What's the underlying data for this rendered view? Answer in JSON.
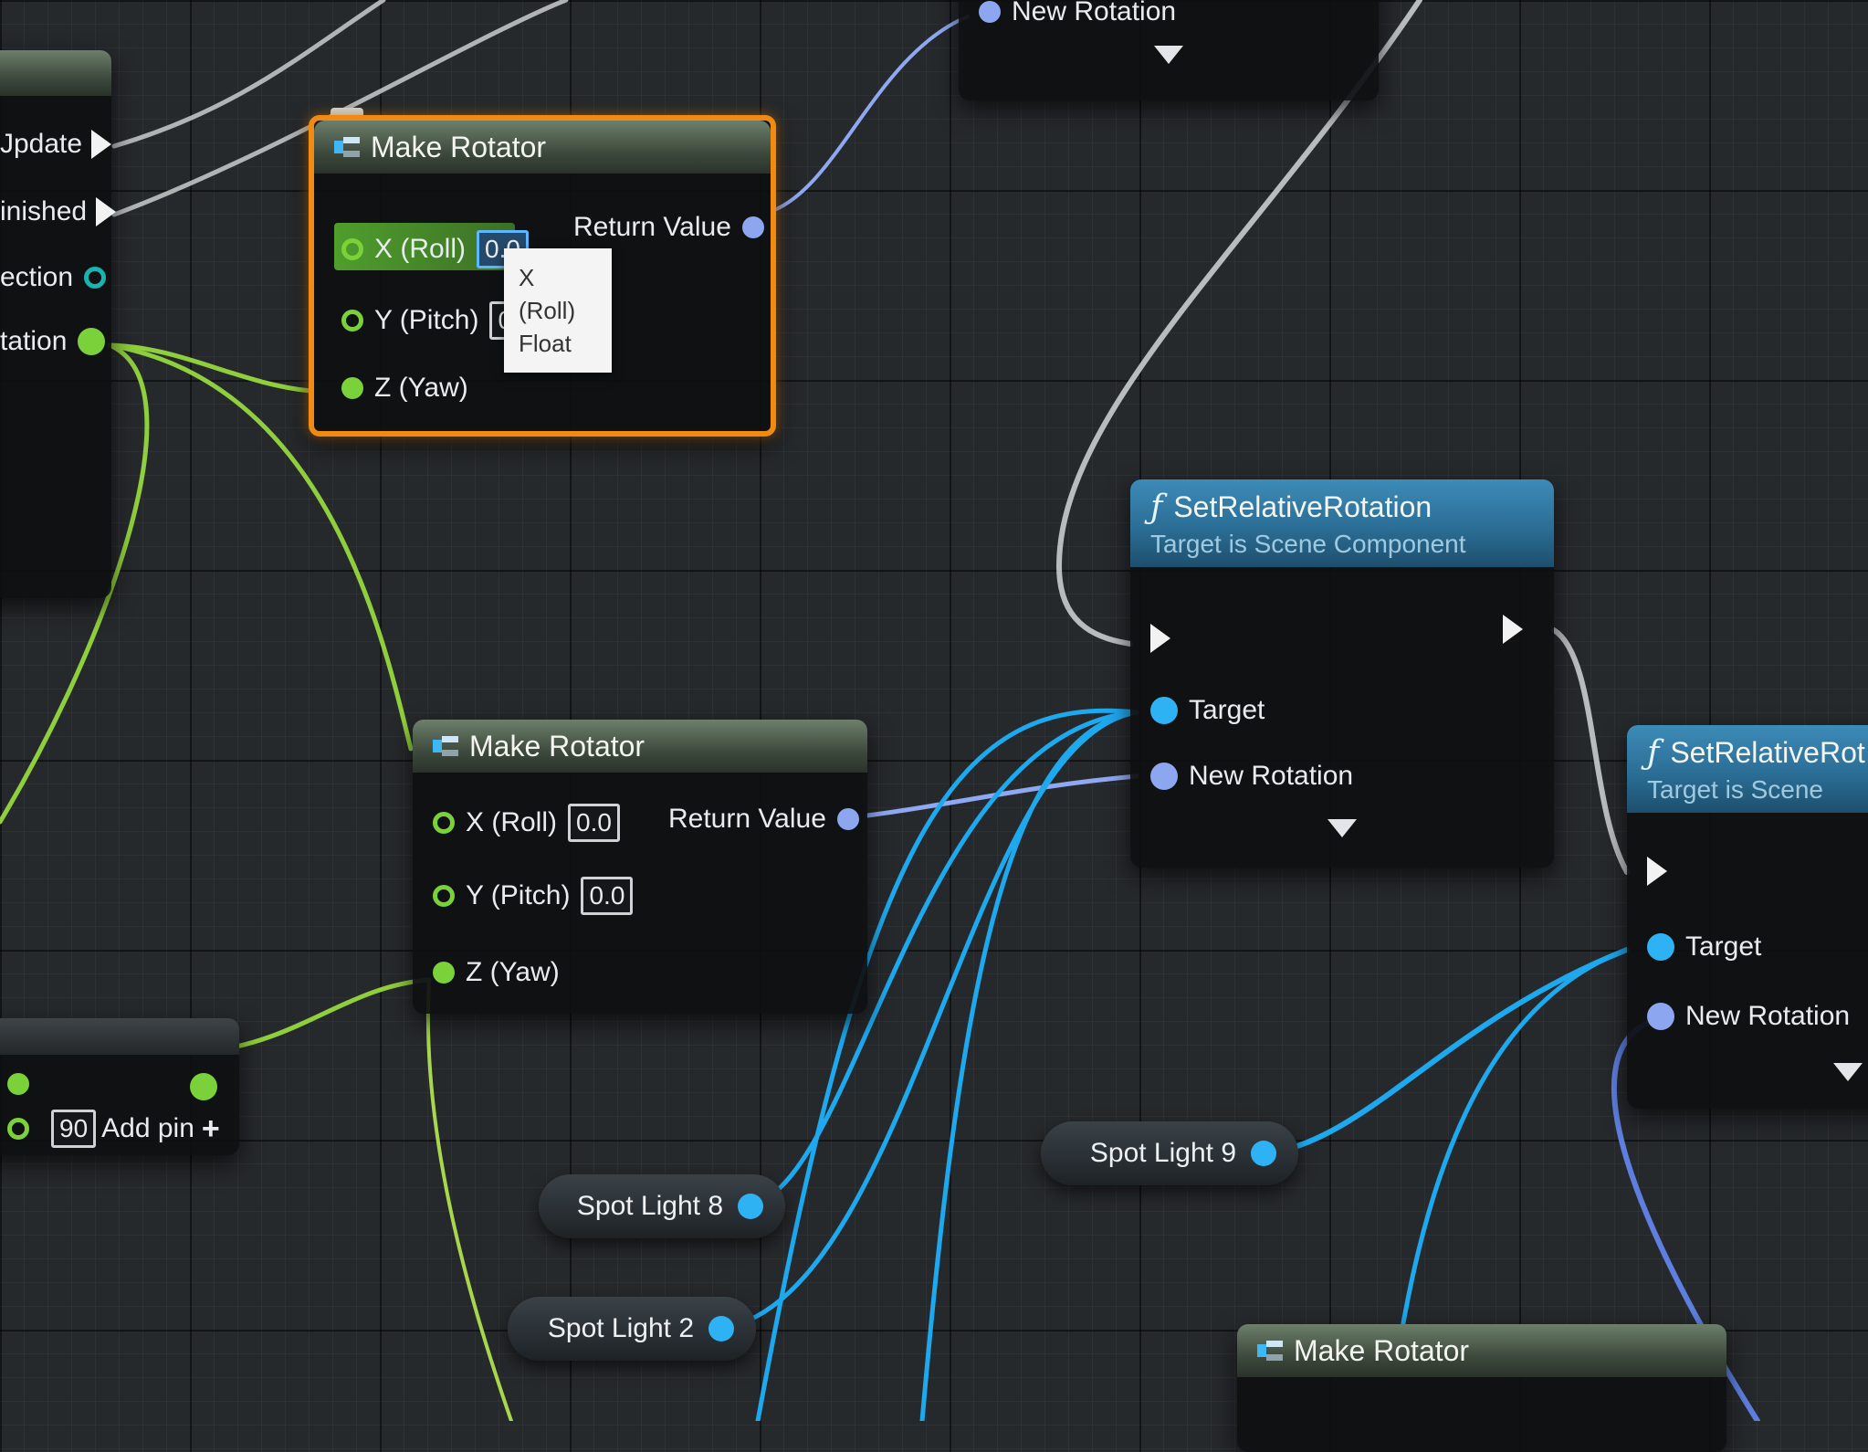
{
  "left_node": {
    "pins": [
      "Update",
      "Finished",
      "Direction",
      "New Rotation"
    ],
    "pins_visible": [
      "Jpdate",
      "inished",
      "ection",
      "tation"
    ]
  },
  "top_partial_node": {
    "pin_label": "New Rotation"
  },
  "make_rotator_1": {
    "title": "Make Rotator",
    "x_label": "X (Roll)",
    "x_value": "0.0",
    "y_label": "Y (Pitch)",
    "y_value": "0.",
    "z_label": "Z (Yaw)",
    "return_label": "Return Value",
    "tooltip_name": "X (Roll)",
    "tooltip_type": "Float"
  },
  "make_rotator_2": {
    "title": "Make Rotator",
    "x_label": "X (Roll)",
    "x_value": "0.0",
    "y_label": "Y (Pitch)",
    "y_value": "0.0",
    "z_label": "Z (Yaw)",
    "return_label": "Return Value"
  },
  "set_rotation_1": {
    "title": "SetRelativeRotation",
    "subtitle": "Target is Scene Component",
    "target_label": "Target",
    "new_rotation_label": "New Rotation"
  },
  "set_rotation_2": {
    "title": "SetRelativeRot",
    "subtitle": "Target is Scene",
    "target_label": "Target",
    "new_rotation_label": "New Rotation"
  },
  "make_rotator_3": {
    "title": "Make Rotator"
  },
  "math_node": {
    "value": "90",
    "add_pin_label": "Add pin"
  },
  "variables": {
    "spot_light_8": "Spot Light 8",
    "spot_light_2": "Spot Light 2",
    "spot_light_9": "Spot Light 9"
  },
  "colors": {
    "exec_wire": "#c9ccce",
    "rotator_wire": "#8fa8f2",
    "object_wire": "#1ea8ee",
    "float_wire": "#8fce3c",
    "selection": "#f08a12",
    "function_header": "#2b6e96"
  },
  "icons": [
    "struct-make-icon",
    "function-icon",
    "comment-icon",
    "dropdown-arrow-icon",
    "add-pin-icon"
  ]
}
